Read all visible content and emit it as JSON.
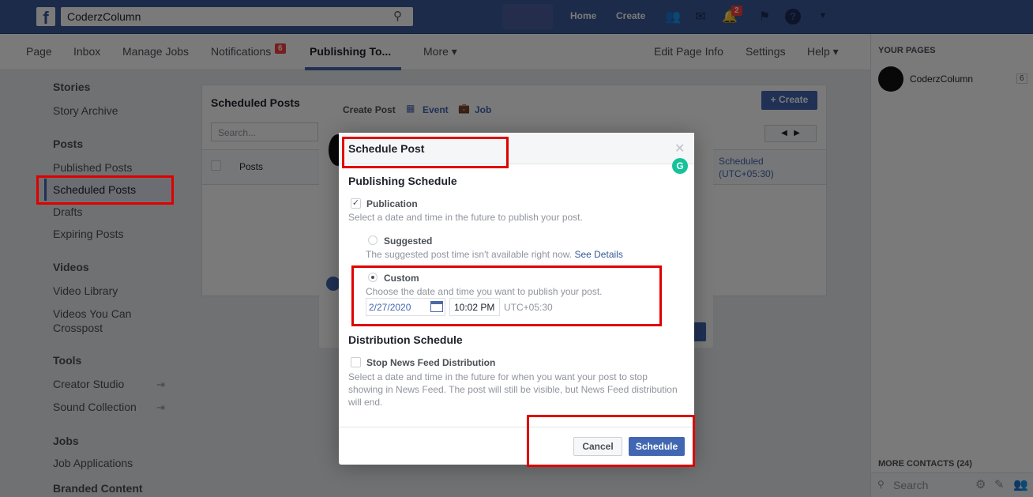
{
  "topbar": {
    "search_value": "CoderzColumn",
    "home": "Home",
    "create": "Create",
    "notif_count": "2"
  },
  "pagenav": {
    "items": [
      "Page",
      "Inbox",
      "Manage Jobs",
      "Notifications",
      "Publishing To...",
      "More ▾"
    ],
    "notif_badge": "6",
    "right": [
      "Edit Page Info",
      "Settings",
      "Help ▾"
    ]
  },
  "sidebar": {
    "stories": "Stories",
    "story_archive": "Story Archive",
    "posts": "Posts",
    "published": "Published Posts",
    "scheduled": "Scheduled Posts",
    "drafts": "Drafts",
    "expiring": "Expiring Posts",
    "videos": "Videos",
    "video_library": "Video Library",
    "crosspost": "Videos You Can Crosspost",
    "tools": "Tools",
    "creator_studio": "Creator Studio",
    "sound_collection": "Sound Collection",
    "jobs": "Jobs",
    "job_applications": "Job Applications",
    "branded": "Branded Content"
  },
  "panel": {
    "title": "Scheduled Posts",
    "create": "+ Create",
    "search_placeholder": "Search...",
    "col_posts": "Posts",
    "scheduled": "Scheduled",
    "tz": "(UTC+05:30)"
  },
  "createpost": {
    "tab_create": "Create Post",
    "tab_event": "Event",
    "tab_job": "Job"
  },
  "rightcol": {
    "your_pages": "YOUR PAGES",
    "page_name": "CoderzColumn",
    "page_count": "6",
    "more_contacts": "MORE CONTACTS (24)",
    "search_placeholder": "Search"
  },
  "dialog": {
    "title": "Schedule Post",
    "publishing_heading": "Publishing Schedule",
    "publication_label": "Publication",
    "publication_desc": "Select a date and time in the future to publish your post.",
    "suggested_label": "Suggested",
    "suggested_desc": "The suggested post time isn't available right now.",
    "see_details": "See Details",
    "custom_label": "Custom",
    "custom_desc": "Choose the date and time you want to publish your post.",
    "date_value": "2/27/2020",
    "time_value": "10:02 PM",
    "timezone": "UTC+05:30",
    "distribution_heading": "Distribution Schedule",
    "stop_label": "Stop News Feed Distribution",
    "stop_desc": "Select a date and time in the future for when you want your post to stop showing in News Feed. The post will still be visible, but News Feed distribution will end.",
    "cancel": "Cancel",
    "schedule": "Schedule"
  },
  "colors": {
    "brand": "#3b5998",
    "highlight": "#e00000",
    "button": "#4267b2"
  }
}
